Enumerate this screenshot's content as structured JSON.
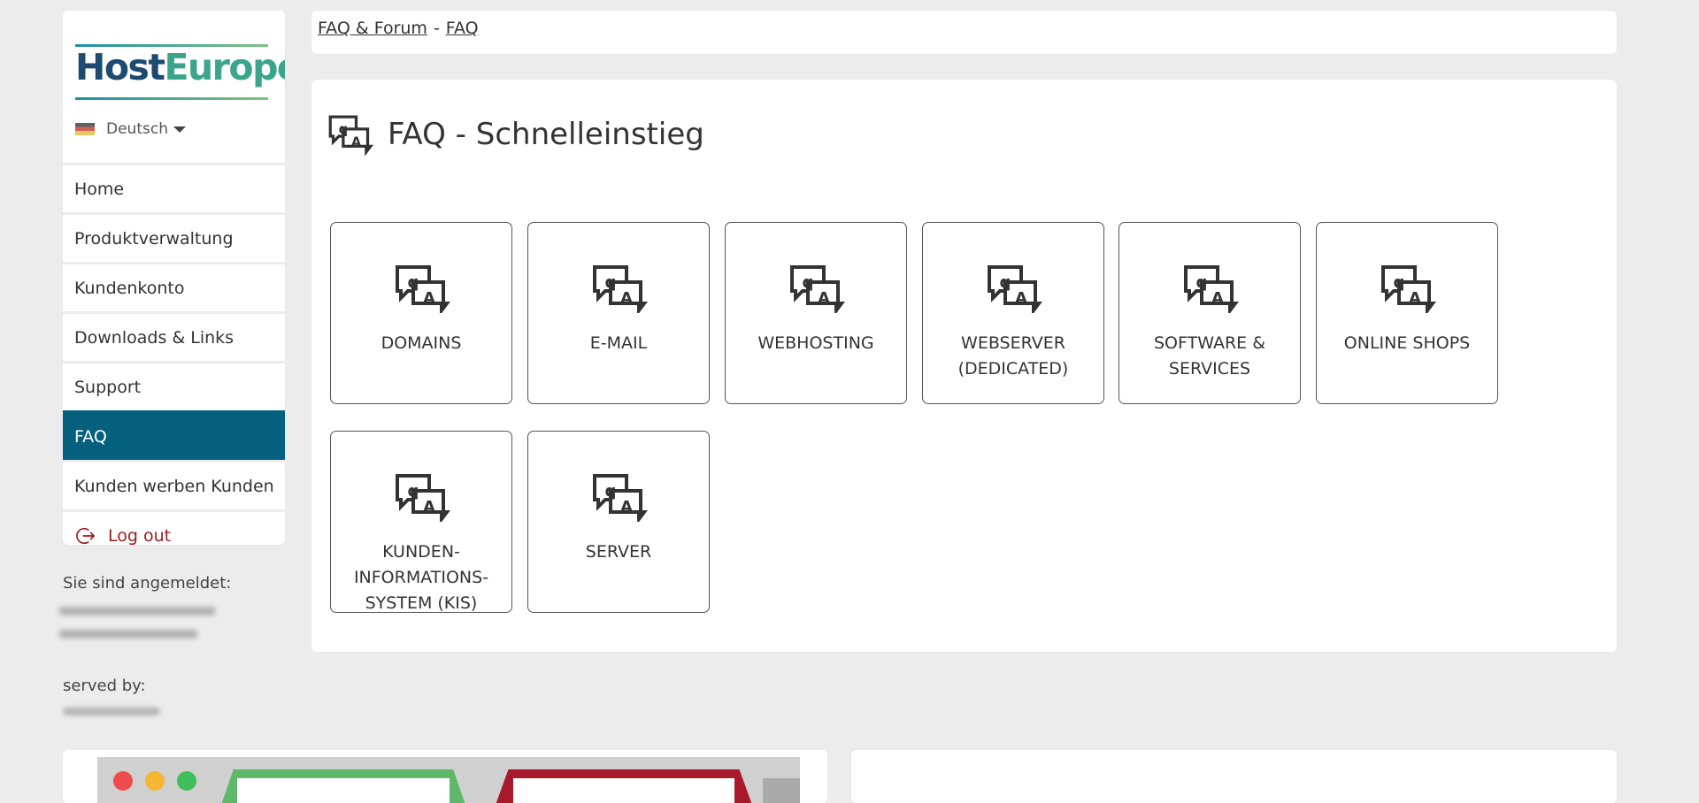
{
  "brand": {
    "logo_text_host": "Host",
    "logo_text_europe": "Europe",
    "primary_color": "#05607d",
    "logout_color": "#9b1b1f"
  },
  "sidebar": {
    "language": "Deutsch",
    "items": [
      {
        "label": "Home",
        "active": false
      },
      {
        "label": "Produktverwaltung",
        "active": false
      },
      {
        "label": "Kundenkonto",
        "active": false
      },
      {
        "label": "Downloads & Links",
        "active": false
      },
      {
        "label": "Support",
        "active": false
      },
      {
        "label": "FAQ",
        "active": true
      },
      {
        "label": "Kunden werben Kunden",
        "active": false
      }
    ],
    "logout_label": "Log out",
    "logged_in_label": "Sie sind angemeldet:",
    "served_by_label": "served by:"
  },
  "breadcrumb": {
    "items": [
      "FAQ & Forum",
      "FAQ"
    ],
    "separator": "-"
  },
  "main": {
    "title": "FAQ - Schnelleinstieg",
    "tiles": [
      {
        "label": "DOMAINS"
      },
      {
        "label": "E-MAIL"
      },
      {
        "label": "WEBHOSTING"
      },
      {
        "label": "WEBSERVER (DEDICATED)"
      },
      {
        "label": "SOFTWARE & SERVICES"
      },
      {
        "label": "ONLINE SHOPS"
      },
      {
        "label": "KUNDEN-INFORMATIONS-SYSTEM (KIS)"
      },
      {
        "label": "SERVER"
      }
    ]
  }
}
